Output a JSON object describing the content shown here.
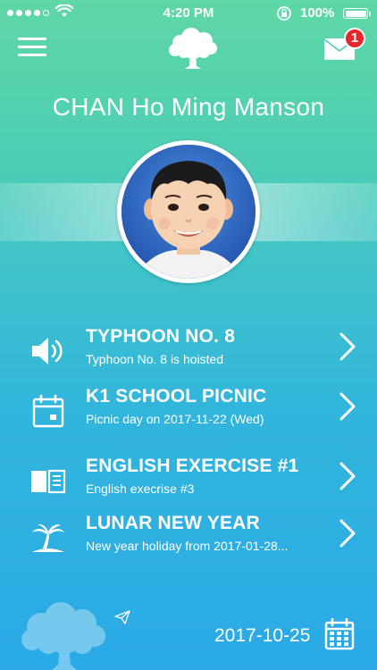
{
  "status_bar": {
    "time": "4:20 PM",
    "battery": "100%"
  },
  "header": {
    "menu_icon": "hamburger-icon",
    "logo_icon": "tree-icon",
    "mail_icon": "envelope-icon",
    "unread_count": "1"
  },
  "student": {
    "name": "CHAN Ho Ming Manson"
  },
  "notices": [
    {
      "icon": "speaker-icon",
      "title": "TYPHOON NO. 8",
      "subtitle": "Typhoon No. 8 is hoisted"
    },
    {
      "icon": "calendar-icon",
      "title": "K1 SCHOOL PICNIC",
      "subtitle": "Picnic day on 2017-11-22 (Wed)"
    },
    {
      "icon": "book-icon",
      "title": "ENGLISH EXERCISE #1",
      "subtitle": "English execrise #3"
    },
    {
      "icon": "palm-tree-icon",
      "title": "LUNAR NEW YEAR",
      "subtitle": "New year holiday from 2017-01-28..."
    }
  ],
  "footer": {
    "date": "2017-10-25"
  },
  "colors": {
    "gradient_top": "#5fd7a6",
    "gradient_bottom": "#2aa9e6",
    "badge": "#e8262c",
    "text": "#ffffff"
  }
}
